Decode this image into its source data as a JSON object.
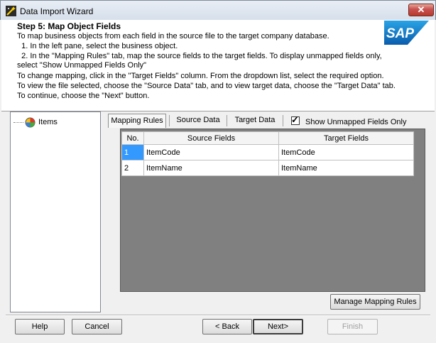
{
  "window": {
    "title": "Data Import Wizard",
    "close_symbol": "✕"
  },
  "header": {
    "step_title": "Step 5: Map Object Fields",
    "lines": [
      "To map business objects from each field in the source file to the target company database.",
      "  1. In the left pane, select the business object.",
      "  2. In the \"Mapping Rules\" tab, map the source fields to the target fields. To display unmapped fields only,",
      "select \"Show Unmapped Fields Only\"",
      "To change mapping, click in the \"Target Fields\" column. From the dropdown list, select the required option.",
      "To view the file selected, choose the \"Source Data\" tab, and to view target data, choose the \"Target Data\" tab.",
      "To continue, choose the \"Next\" button."
    ],
    "logo_text": "SAP"
  },
  "tree": {
    "items": [
      {
        "label": "Items",
        "icon": "business-object-icon"
      }
    ]
  },
  "tabs": [
    {
      "label": "Mapping Rules",
      "active": true
    },
    {
      "label": "Source Data",
      "active": false
    },
    {
      "label": "Target Data",
      "active": false
    }
  ],
  "show_unmapped": {
    "label": "Show Unmapped Fields Only",
    "checked": true,
    "mark": "✓"
  },
  "grid": {
    "columns": [
      "No.",
      "Source  Fields",
      "Target Fields"
    ],
    "rows": [
      {
        "no": "1",
        "source": "ItemCode",
        "target": "ItemCode",
        "selected": true
      },
      {
        "no": "2",
        "source": "ItemName",
        "target": "ItemName",
        "selected": false
      }
    ]
  },
  "buttons": {
    "manage": "Manage Mapping Rules",
    "help": "Help",
    "cancel": "Cancel",
    "back": "< Back",
    "next": "Next>",
    "finish": "Finish"
  },
  "colors": {
    "selection": "#3399ff",
    "grid_background": "#808080",
    "sap_blue": "#0a5cac"
  }
}
